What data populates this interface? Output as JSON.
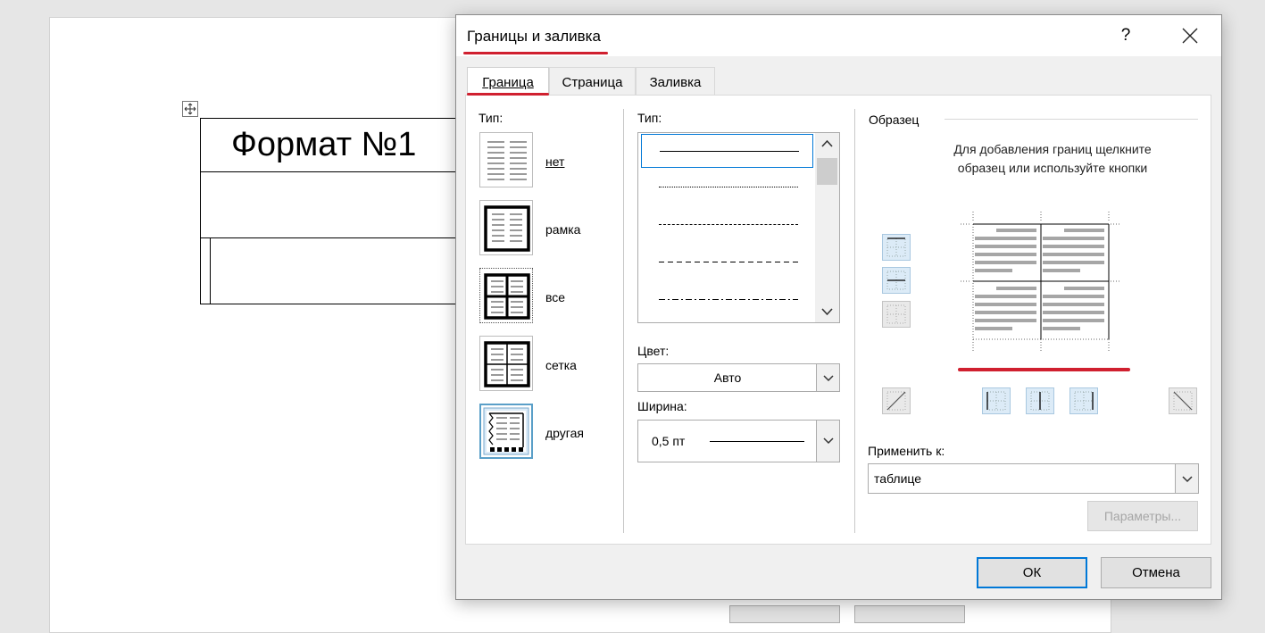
{
  "document": {
    "title_cell": "Формат №1"
  },
  "dialog": {
    "title": "Границы и заливка",
    "help": "?",
    "tabs": [
      {
        "label": "Граница",
        "active": true
      },
      {
        "label": "Страница",
        "active": false
      },
      {
        "label": "Заливка",
        "active": false
      }
    ],
    "presets": {
      "label": "Тип:",
      "items": [
        {
          "label": "нет",
          "icon": "preset-none-icon"
        },
        {
          "label": "рамка",
          "icon": "preset-box-icon"
        },
        {
          "label": "все",
          "icon": "preset-all-icon"
        },
        {
          "label": "сетка",
          "icon": "preset-grid-icon"
        },
        {
          "label": "другая",
          "icon": "preset-custom-icon",
          "selected": true
        }
      ]
    },
    "style": {
      "label": "Тип:",
      "items": [
        "solid",
        "dotted",
        "dashed-small",
        "dashed",
        "dash-dot"
      ],
      "selected": "solid"
    },
    "color": {
      "label": "Цвет:",
      "value": "Авто"
    },
    "width": {
      "label": "Ширина:",
      "value": "0,5 пт"
    },
    "preview": {
      "label": "Образец",
      "instruction_line1": "Для добавления границ щелкните",
      "instruction_line2": "образец или используйте кнопки"
    },
    "apply_to": {
      "label": "Применить к:",
      "value": "таблице"
    },
    "options_button": "Параметры...",
    "ok_button": "ОК",
    "cancel_button": "Отмена"
  },
  "colors": {
    "accent": "#0078d7",
    "annotation_red": "#d0202f"
  }
}
